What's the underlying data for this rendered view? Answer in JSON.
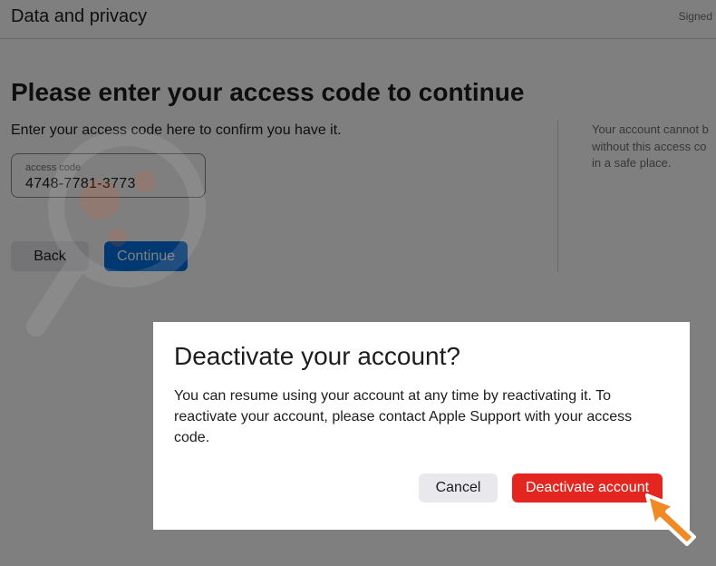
{
  "header": {
    "title": "Data and privacy",
    "signed_in": "Signed"
  },
  "main": {
    "heading": "Please enter your access code to continue",
    "subtext": "Enter your access code here to confirm you have it.",
    "code_field": {
      "label": "access code",
      "value": "4748-7781-3773"
    },
    "back_label": "Back",
    "continue_label": "Continue"
  },
  "side_note": {
    "lines": [
      "Your account cannot b",
      "without this access co",
      "in a safe place."
    ]
  },
  "dialog": {
    "title": "Deactivate your account?",
    "body_lines": [
      "You can resume using your account at any time by reactivating it. To",
      "reactivate your account, please contact Apple Support with your access",
      "code."
    ],
    "cancel_label": "Cancel",
    "deactivate_label": "Deactivate account"
  },
  "colors": {
    "primary_blue": "#0071e3",
    "danger_red": "#e3261f",
    "secondary_gray": "#e8e8ed",
    "pointer_orange": "#f08a24"
  },
  "icons": {
    "pointer": "pointer-arrow-icon",
    "watermark": "magnifier-watermark-icon"
  }
}
